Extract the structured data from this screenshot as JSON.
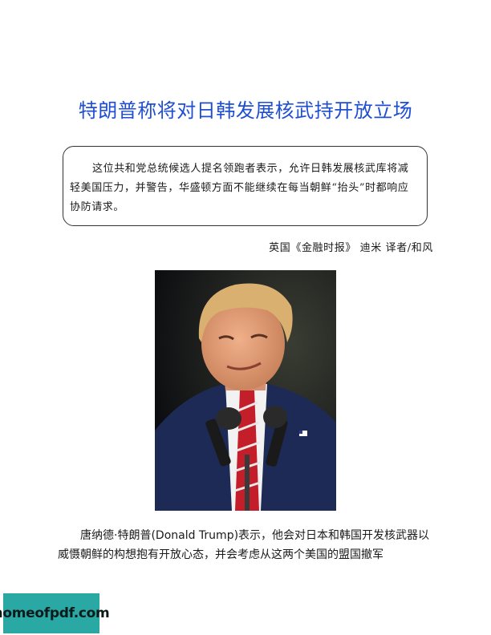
{
  "article": {
    "title": "特朗普称将对日韩发展核武持开放立场",
    "summary": "这位共和党总统候选人提名领跑者表示，允许日韩发展核武库将减轻美国压力，并警告，华盛顿方面不能继续在每当朝鲜“抬头”时都响应协防请求。",
    "byline": "英国《金融时报》 迪米 译者/和风",
    "body": "唐纳德·特朗普(Donald Trump)表示，他会对日本和韩国开发核武器以威慑朝鲜的构想抱有开放心态，并会考虑从这两个美国的盟国撤军"
  },
  "watermark": {
    "text": "homeofpdf.com",
    "color": "#2aa8a4"
  },
  "colors": {
    "title": "#1f4fd0"
  }
}
